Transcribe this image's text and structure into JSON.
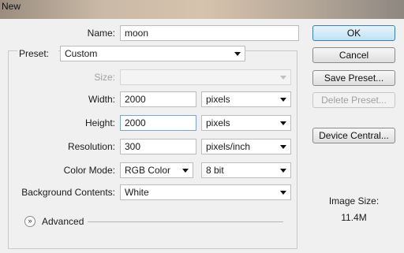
{
  "window": {
    "title": "New"
  },
  "form": {
    "name_label": "Name:",
    "name_value": "moon",
    "preset_label": "Preset:",
    "preset_value": "Custom",
    "size_label": "Size:",
    "size_value": "",
    "width_label": "Width:",
    "width_value": "2000",
    "width_unit": "pixels",
    "height_label": "Height:",
    "height_value": "2000",
    "height_unit": "pixels",
    "resolution_label": "Resolution:",
    "resolution_value": "300",
    "resolution_unit": "pixels/inch",
    "color_mode_label": "Color Mode:",
    "color_mode_value": "RGB Color",
    "bit_depth_value": "8 bit",
    "background_label": "Background Contents:",
    "background_value": "White",
    "advanced_label": "Advanced"
  },
  "buttons": {
    "ok": "OK",
    "cancel": "Cancel",
    "save_preset": "Save Preset...",
    "delete_preset": "Delete Preset...",
    "device_central": "Device Central..."
  },
  "image_size": {
    "label": "Image Size:",
    "value": "11.4M"
  },
  "icons": {
    "advanced_toggle": "chevron-double-down-icon",
    "dropdown": "chevron-down-icon"
  }
}
